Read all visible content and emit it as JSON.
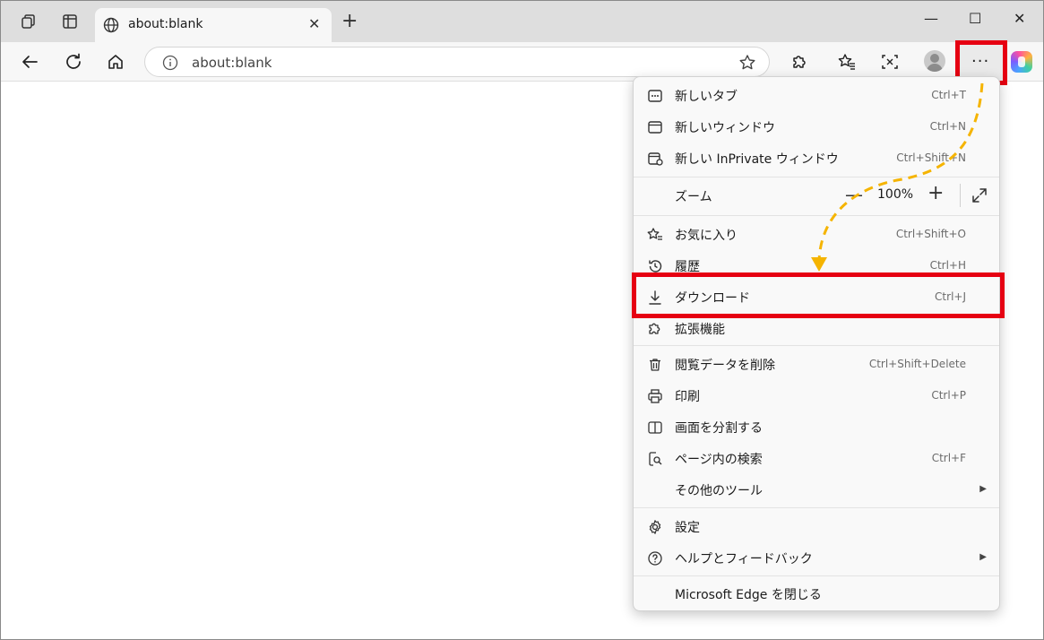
{
  "tab": {
    "title": "about:blank",
    "close_glyph": "✕"
  },
  "newtab_glyph": "+",
  "window_controls": {
    "minimize": "—",
    "maximize": "☐",
    "close": "✕"
  },
  "address": {
    "url": "about:blank"
  },
  "more_glyph": "···",
  "icons": {
    "workspaces": "workspaces-icon",
    "tab-actions": "tab-actions-icon",
    "back": "back-arrow-icon",
    "refresh": "refresh-icon",
    "home": "home-icon",
    "info": "info-icon",
    "favorite": "star-icon",
    "extensions": "puzzle-icon",
    "favorites-bar": "favorites-icon",
    "screenshot": "screenshot-icon",
    "profile": "profile-icon",
    "copilot": "copilot-icon"
  },
  "menu": {
    "new_tab": {
      "label": "新しいタブ",
      "shortcut": "Ctrl+T"
    },
    "new_window": {
      "label": "新しいウィンドウ",
      "shortcut": "Ctrl+N"
    },
    "new_inprivate": {
      "label": "新しい InPrivate ウィンドウ",
      "shortcut": "Ctrl+Shift+N"
    },
    "zoom": {
      "label": "ズーム",
      "minus": "—",
      "value": "100%",
      "plus": "+"
    },
    "favorites": {
      "label": "お気に入り",
      "shortcut": "Ctrl+Shift+O"
    },
    "history": {
      "label": "履歴",
      "shortcut": "Ctrl+H"
    },
    "downloads": {
      "label": "ダウンロード",
      "shortcut": "Ctrl+J"
    },
    "extensions": {
      "label": "拡張機能"
    },
    "clear_data": {
      "label": "閲覧データを削除",
      "shortcut": "Ctrl+Shift+Delete"
    },
    "print": {
      "label": "印刷",
      "shortcut": "Ctrl+P"
    },
    "split_screen": {
      "label": "画面を分割する"
    },
    "find": {
      "label": "ページ内の検索",
      "shortcut": "Ctrl+F"
    },
    "more_tools": {
      "label": "その他のツール",
      "arrow": "▶"
    },
    "settings": {
      "label": "設定"
    },
    "help": {
      "label": "ヘルプとフィードバック",
      "arrow": "▶"
    },
    "close_edge": {
      "label": "Microsoft Edge を閉じる"
    }
  },
  "annotation": {
    "highlight_color": "#e60012",
    "arrow_color": "#f5b400"
  }
}
